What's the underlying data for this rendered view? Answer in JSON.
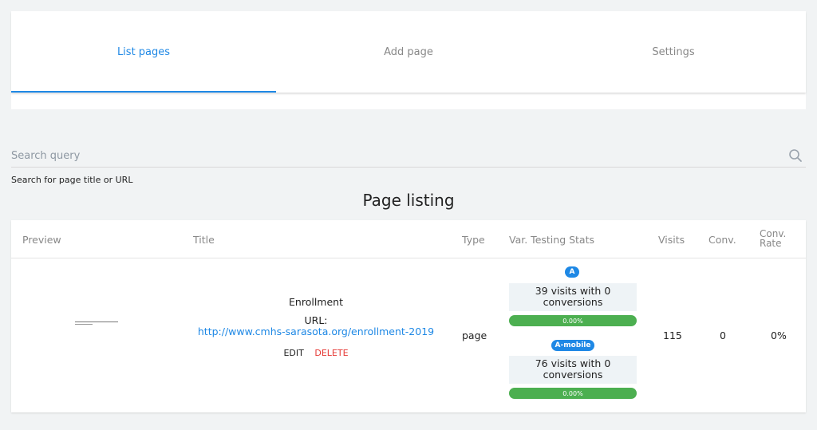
{
  "tabs": [
    {
      "label": "List pages",
      "active": true
    },
    {
      "label": "Add page",
      "active": false
    },
    {
      "label": "Settings",
      "active": false
    }
  ],
  "search": {
    "placeholder": "Search query",
    "value": "",
    "hint": "Search for page title or URL",
    "icon": "search-icon"
  },
  "listing": {
    "heading": "Page listing",
    "columns": {
      "preview": "Preview",
      "title": "Title",
      "type": "Type",
      "var_stats": "Var. Testing Stats",
      "visits": "Visits",
      "conv": "Conv.",
      "rate_line1": "Conv.",
      "rate_line2": "Rate"
    },
    "rows": [
      {
        "title": "Enrollment",
        "url_label": "URL:",
        "url": "http://www.cmhs-sarasota.org/enrollment-2019",
        "edit": "EDIT",
        "delete": "DELETE",
        "type": "page",
        "variants": [
          {
            "label": "A",
            "stats_line1": "39 visits with 0",
            "stats_line2": "conversions",
            "rate": "0.00%"
          },
          {
            "label": "A-mobile",
            "stats_line1": "76 visits with 0",
            "stats_line2": "conversions",
            "rate": "0.00%"
          }
        ],
        "visits": "115",
        "conv": "0",
        "rate": "0%"
      }
    ]
  },
  "colors": {
    "accent": "#1e88e5",
    "delete": "#e53935",
    "progress": "#4caf50",
    "background": "#f1f3f4"
  }
}
